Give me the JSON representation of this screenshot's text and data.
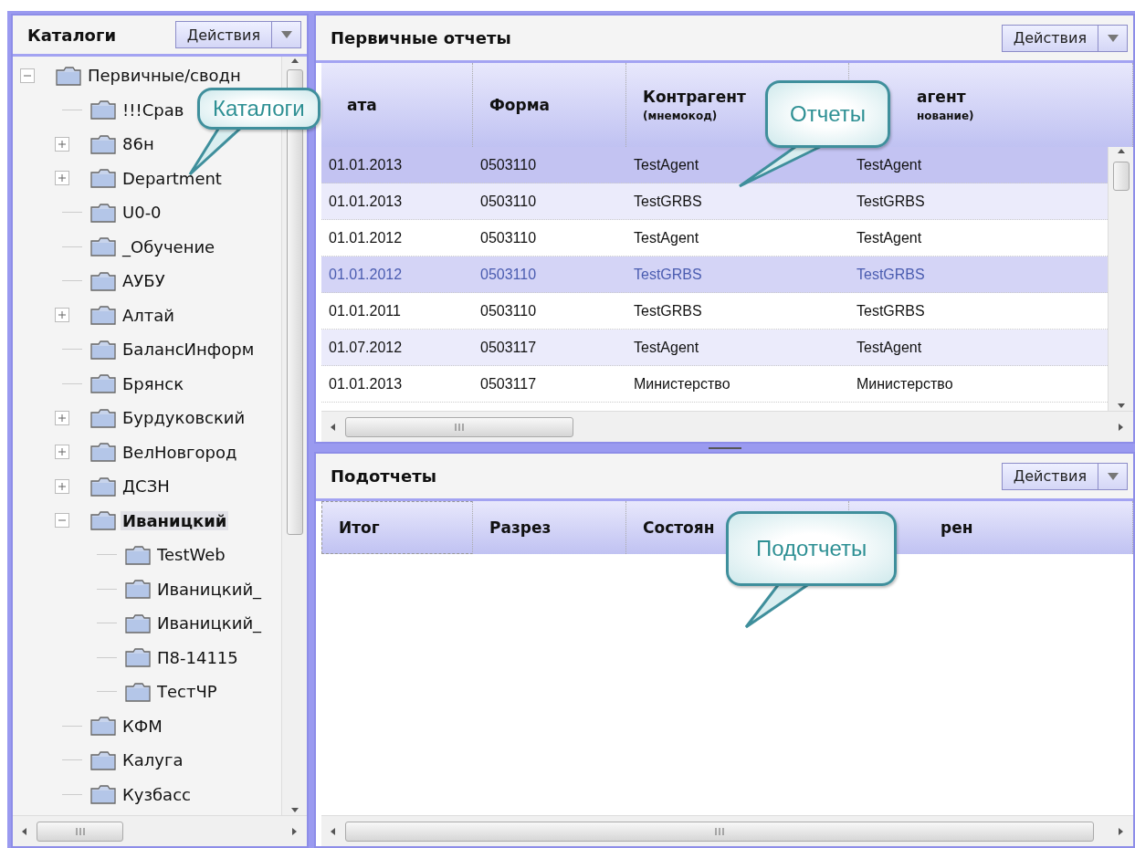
{
  "catalogs": {
    "title": "Каталоги",
    "actions_button": "Действия",
    "tree": [
      {
        "label": "Первичные/сводн",
        "kind": "branch",
        "expanded": true,
        "selected": false,
        "children": [
          {
            "label": "!!!Срав",
            "kind": "leaf",
            "selected": false
          },
          {
            "label": "86н",
            "kind": "branch",
            "expanded": false,
            "selected": false
          },
          {
            "label": "Department",
            "kind": "branch",
            "expanded": false,
            "selected": false
          },
          {
            "label": "U0-0",
            "kind": "leaf",
            "selected": false
          },
          {
            "label": "_Обучение",
            "kind": "leaf",
            "selected": false
          },
          {
            "label": "АУБУ",
            "kind": "leaf",
            "selected": false
          },
          {
            "label": "Алтай",
            "kind": "branch",
            "expanded": false,
            "selected": false
          },
          {
            "label": "БалансИнформ",
            "kind": "leaf",
            "selected": false
          },
          {
            "label": "Брянск",
            "kind": "leaf",
            "selected": false
          },
          {
            "label": "Бурдуковский",
            "kind": "branch",
            "expanded": false,
            "selected": false
          },
          {
            "label": "ВелНовгород",
            "kind": "branch",
            "expanded": false,
            "selected": false
          },
          {
            "label": "ДСЗН",
            "kind": "branch",
            "expanded": false,
            "selected": false
          },
          {
            "label": "Иваницкий",
            "kind": "branch",
            "expanded": true,
            "selected": true,
            "children": [
              {
                "label": "TestWeb",
                "kind": "leaf",
                "selected": false
              },
              {
                "label": "Иваницкий_",
                "kind": "leaf",
                "selected": false
              },
              {
                "label": "Иваницкий_",
                "kind": "leaf",
                "selected": false
              },
              {
                "label": "П8-14115",
                "kind": "leaf",
                "selected": false
              },
              {
                "label": "ТестЧР",
                "kind": "leaf",
                "selected": false
              }
            ]
          },
          {
            "label": "КФМ",
            "kind": "leaf",
            "selected": false
          },
          {
            "label": "Калуга",
            "kind": "leaf",
            "selected": false
          },
          {
            "label": "Кузбасс",
            "kind": "leaf",
            "selected": false
          }
        ]
      }
    ]
  },
  "reports": {
    "title": "Первичные отчеты",
    "actions_button": "Действия",
    "columns": [
      {
        "label": "ата"
      },
      {
        "label": "Форма"
      },
      {
        "label": "Контрагент",
        "sub": "(мнемокод)"
      },
      {
        "label": "агент",
        "sub": "нование)"
      }
    ],
    "rows": [
      {
        "cells": [
          "01.01.2013",
          "0503110",
          "TestAgent",
          "TestAgent"
        ],
        "selected": true,
        "highlighted": false
      },
      {
        "cells": [
          "01.01.2013",
          "0503110",
          "TestGRBS",
          "TestGRBS"
        ],
        "selected": false,
        "highlighted": false
      },
      {
        "cells": [
          "01.01.2012",
          "0503110",
          "TestAgent",
          "TestAgent"
        ],
        "selected": false,
        "highlighted": false
      },
      {
        "cells": [
          "01.01.2012",
          "0503110",
          "TestGRBS",
          "TestGRBS"
        ],
        "selected": false,
        "highlighted": true
      },
      {
        "cells": [
          "01.01.2011",
          "0503110",
          "TestGRBS",
          "TestGRBS"
        ],
        "selected": false,
        "highlighted": false
      },
      {
        "cells": [
          "01.07.2012",
          "0503117",
          "TestAgent",
          "TestAgent"
        ],
        "selected": false,
        "highlighted": false
      },
      {
        "cells": [
          "01.01.2013",
          "0503117",
          "Министерство",
          "Министерство"
        ],
        "selected": false,
        "highlighted": false
      }
    ]
  },
  "subreports": {
    "title": "Подотчеты",
    "actions_button": "Действия",
    "columns": [
      {
        "label": "Итог",
        "focused": true
      },
      {
        "label": "Разрез",
        "focused": false
      },
      {
        "label": "Состоян",
        "focused": false
      },
      {
        "label": "рен",
        "focused": false
      }
    ]
  },
  "callouts": [
    {
      "text": "Каталоги"
    },
    {
      "text": "Отчеты"
    },
    {
      "text": "Подотчеты"
    }
  ]
}
